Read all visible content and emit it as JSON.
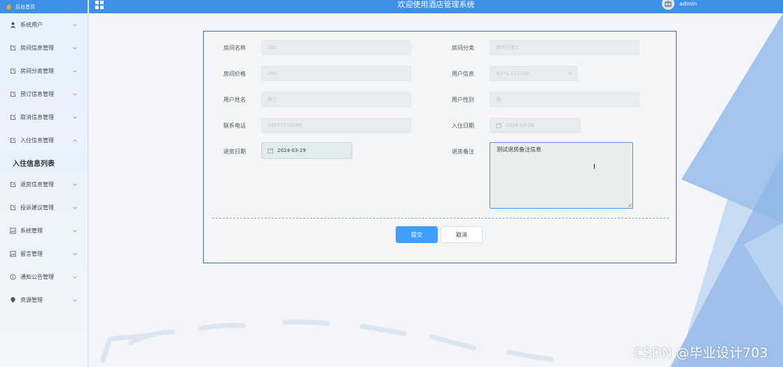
{
  "header": {
    "title": "欢迎使用酒店管理系统",
    "username": "admin"
  },
  "sidebar": {
    "home_label": "后台首页",
    "items": [
      {
        "label": "系统用户",
        "icon": "user-icon",
        "chevron": "down"
      },
      {
        "label": "房间信息管理",
        "icon": "edit-icon",
        "chevron": "down"
      },
      {
        "label": "房间分类管理",
        "icon": "edit-icon",
        "chevron": "down"
      },
      {
        "label": "预订信息管理",
        "icon": "edit-icon",
        "chevron": "down"
      },
      {
        "label": "取消信息管理",
        "icon": "edit-icon",
        "chevron": "down"
      },
      {
        "label": "入住信息管理",
        "icon": "edit-icon",
        "chevron": "up"
      },
      {
        "label": "退房信息管理",
        "icon": "edit-icon",
        "chevron": "down"
      },
      {
        "label": "投诉建议管理",
        "icon": "edit-icon",
        "chevron": "down"
      },
      {
        "label": "系统管理",
        "icon": "picture-icon",
        "chevron": "down"
      },
      {
        "label": "留言管理",
        "icon": "picture-icon",
        "chevron": "down"
      },
      {
        "label": "通知公告管理",
        "icon": "info-icon",
        "chevron": "down"
      },
      {
        "label": "资源管理",
        "icon": "location-icon",
        "chevron": "down"
      }
    ],
    "sub_item_label": "入住信息列表"
  },
  "form": {
    "room_name": {
      "label": "房间名称",
      "value": "201"
    },
    "room_category": {
      "label": "房间分类",
      "value": "房间分类1"
    },
    "room_price": {
      "label": "房间价格",
      "value": "258"
    },
    "user_info": {
      "label": "用户信息",
      "value": "用户1 112233"
    },
    "user_name": {
      "label": "用户姓名",
      "value": "张三"
    },
    "user_gender": {
      "label": "用户性别",
      "value": "男"
    },
    "phone": {
      "label": "联系电话",
      "value": "18977778899"
    },
    "checkin_date": {
      "label": "入住日期",
      "value": "2024-03-29"
    },
    "checkout_date": {
      "label": "退房日期",
      "value": "2024-03-29"
    },
    "checkout_note": {
      "label": "退房备注",
      "value": "测试退房备注信息"
    },
    "submit_label": "提交",
    "cancel_label": "取消"
  },
  "watermark": "CSDN @毕业设计703",
  "colors": {
    "header_bg": "#3d8fe8",
    "primary_button": "#409eff",
    "card_border": "#3e6ea6"
  }
}
